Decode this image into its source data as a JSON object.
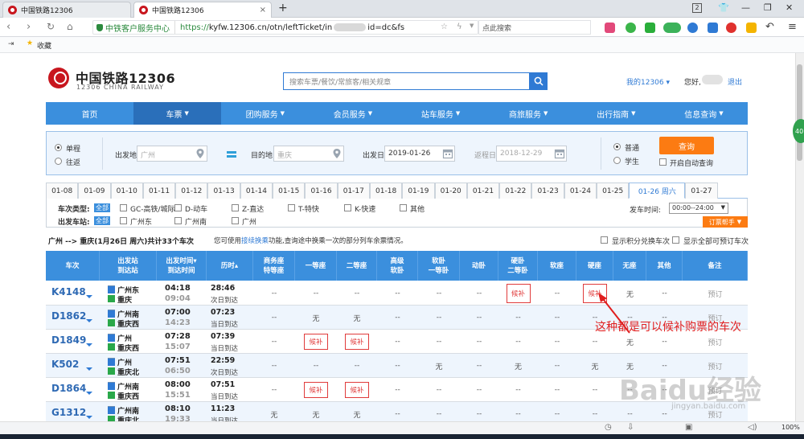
{
  "browser": {
    "tabs": [
      {
        "title": "中国铁路12306"
      },
      {
        "title": "中国铁路12306"
      }
    ],
    "new_tab": "+",
    "tab_count": "2",
    "cert_label": "中铁客户服务中心",
    "url_scheme": "https://",
    "url_rest": "kyfw.12306.cn/otn/leftTicket/in",
    "url_tail": "id=dc&fs",
    "search_label": "点此搜索",
    "bookmarks_label": "收藏",
    "zoom": "100%"
  },
  "site": {
    "logo_name": "中国铁路12306",
    "logo_sub": "12306 CHINA RAILWAY",
    "search_placeholder": "搜索车票/餐饮/常旅客/相关规章",
    "my_account": "我的12306",
    "greeting": "您好,",
    "logout": "退出",
    "nav": [
      "首页",
      "车票",
      "团购服务",
      "会员服务",
      "站车服务",
      "商旅服务",
      "出行指南",
      "信息查询"
    ]
  },
  "query": {
    "trip_single": "单程",
    "trip_round": "往返",
    "from_label": "出发地",
    "from_value": "广州",
    "to_label": "目的地",
    "to_value": "重庆",
    "depart_label": "出发日",
    "depart_value": "2019-01-26",
    "return_label": "返程日",
    "return_value": "2018-12-29",
    "passenger_normal": "普通",
    "passenger_student": "学生",
    "query_button": "查询",
    "auto_query": "开启自动查询"
  },
  "dates": [
    "01-08",
    "01-09",
    "01-10",
    "01-11",
    "01-12",
    "01-13",
    "01-14",
    "01-15",
    "01-16",
    "01-17",
    "01-18",
    "01-19",
    "01-20",
    "01-21",
    "01-22",
    "01-23",
    "01-24",
    "01-25",
    "01-26 周六",
    "01-27"
  ],
  "filters": {
    "type_label": "车次类型:",
    "station_label": "出发车站:",
    "all": "全部",
    "types": [
      "GC-高铁/城际",
      "D-动车",
      "Z-直达",
      "T-特快",
      "K-快速",
      "其他"
    ],
    "stations": [
      "广州东",
      "广州南",
      "广州"
    ],
    "time_label": "发车时间:",
    "time_value": "00:00--24:00",
    "help_button": "订票帮手"
  },
  "route": {
    "summary": "广州 --> 重庆(1月26日 周六)共计33个车次",
    "hint_pre": "您可使用",
    "hint_link": "接续换乘",
    "hint_post": "功能,查询途中换乘一次的部分列车余票情况。",
    "opt1": "显示积分兑换车次",
    "opt2": "显示全部可预订车次"
  },
  "table": {
    "headers": [
      {
        "l1": "车次",
        "l2": ""
      },
      {
        "l1": "出发站",
        "l2": "到达站"
      },
      {
        "l1": "出发时间▾",
        "l2": "到达时间"
      },
      {
        "l1": "历时▴",
        "l2": ""
      },
      {
        "l1": "商务座",
        "l2": "特等座"
      },
      {
        "l1": "一等座",
        "l2": ""
      },
      {
        "l1": "二等座",
        "l2": ""
      },
      {
        "l1": "高级",
        "l2": "软卧"
      },
      {
        "l1": "软卧",
        "l2": "一等卧"
      },
      {
        "l1": "动卧",
        "l2": ""
      },
      {
        "l1": "硬卧",
        "l2": "二等卧"
      },
      {
        "l1": "软座",
        "l2": ""
      },
      {
        "l1": "硬座",
        "l2": ""
      },
      {
        "l1": "无座",
        "l2": ""
      },
      {
        "l1": "其他",
        "l2": ""
      },
      {
        "l1": "备注",
        "l2": ""
      }
    ],
    "rows": [
      {
        "train": "K4148",
        "from": "广州东",
        "to": "重庆",
        "dep": "04:18",
        "arr": "09:04",
        "dur": "28:46",
        "day": "次日到达",
        "seats": [
          "--",
          "--",
          "--",
          "--",
          "--",
          "--",
          "候补",
          "--",
          "候补",
          "无",
          "--"
        ],
        "book": "预订"
      },
      {
        "train": "D1862",
        "from": "广州南",
        "to": "重庆西",
        "dep": "07:00",
        "arr": "14:23",
        "dur": "07:23",
        "day": "当日到达",
        "seats": [
          "--",
          "无",
          "无",
          "--",
          "--",
          "--",
          "--",
          "--",
          "--",
          "--",
          "--"
        ],
        "book": "预订"
      },
      {
        "train": "D1849",
        "from": "广州",
        "to": "重庆西",
        "dep": "07:28",
        "arr": "15:07",
        "dur": "07:39",
        "day": "当日到达",
        "seats": [
          "--",
          "候补",
          "候补",
          "--",
          "--",
          "--",
          "--",
          "--",
          "--",
          "无",
          "--"
        ],
        "book": "预订"
      },
      {
        "train": "K502",
        "from": "广州",
        "to": "重庆北",
        "dep": "07:51",
        "arr": "06:50",
        "dur": "22:59",
        "day": "次日到达",
        "seats": [
          "--",
          "--",
          "--",
          "--",
          "无",
          "--",
          "无",
          "--",
          "无",
          "无",
          "--"
        ],
        "book": "预订"
      },
      {
        "train": "D1864",
        "from": "广州南",
        "to": "重庆西",
        "dep": "08:00",
        "arr": "15:51",
        "dur": "07:51",
        "day": "当日到达",
        "seats": [
          "--",
          "候补",
          "候补",
          "--",
          "--",
          "--",
          "--",
          "--",
          "--",
          "--",
          "--"
        ],
        "book": "预订"
      },
      {
        "train": "G1312",
        "from": "广州南",
        "to": "重庆北",
        "dep": "08:10",
        "arr": "19:33",
        "dur": "11:23",
        "day": "当日到达",
        "seats": [
          "无",
          "无",
          "无",
          "--",
          "--",
          "--",
          "--",
          "--",
          "--",
          "--",
          "--"
        ],
        "book": "预订"
      }
    ]
  },
  "annotation": "这种都是可以候补购票的车次",
  "watermark": "Baidu经验",
  "watermark_sub": "jingyan.baidu.com",
  "badge": "40",
  "colors": {
    "brand_blue": "#3b8fdd",
    "orange": "#fc7b12",
    "red": "#c8161e",
    "highlight": "#e03b3b"
  }
}
